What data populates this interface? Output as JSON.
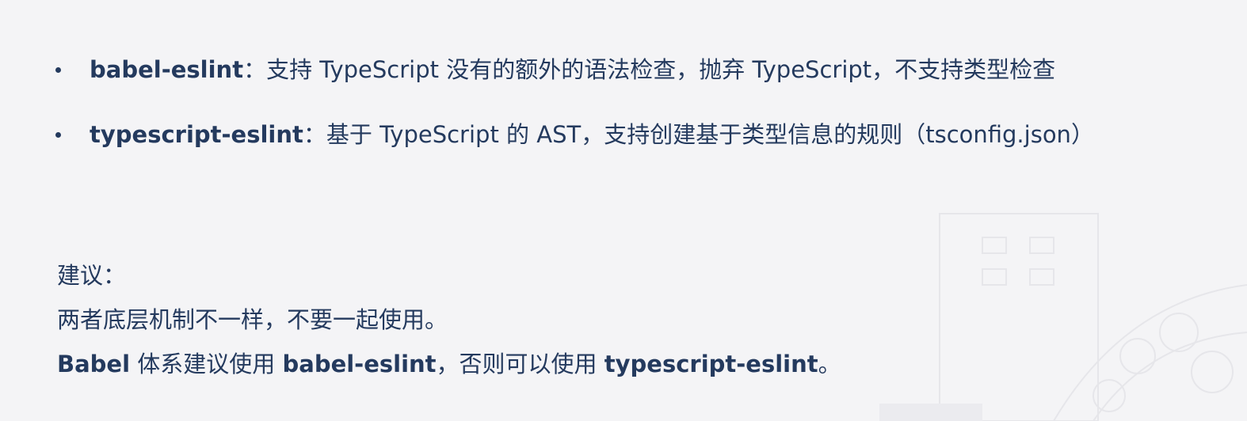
{
  "bullets": [
    {
      "term": "babel-eslint",
      "desc": "：支持 TypeScript 没有的额外的语法检查，抛弃 TypeScript，不支持类型检查"
    },
    {
      "term": "typescript-eslint",
      "desc": "：基于 TypeScript 的 AST，支持创建基于类型信息的规则（tsconfig.json）"
    }
  ],
  "advice": {
    "heading": "建议：",
    "line1": "两者底层机制不一样，不要一起使用。",
    "line2_a": "Babel",
    "line2_b": " 体系建议使用 ",
    "line2_c": "babel-eslint",
    "line2_d": "，否则可以使用 ",
    "line2_e": "typescript-eslint",
    "line2_f": "。"
  },
  "colors": {
    "text": "#243a5e",
    "background": "#f4f4f6"
  }
}
